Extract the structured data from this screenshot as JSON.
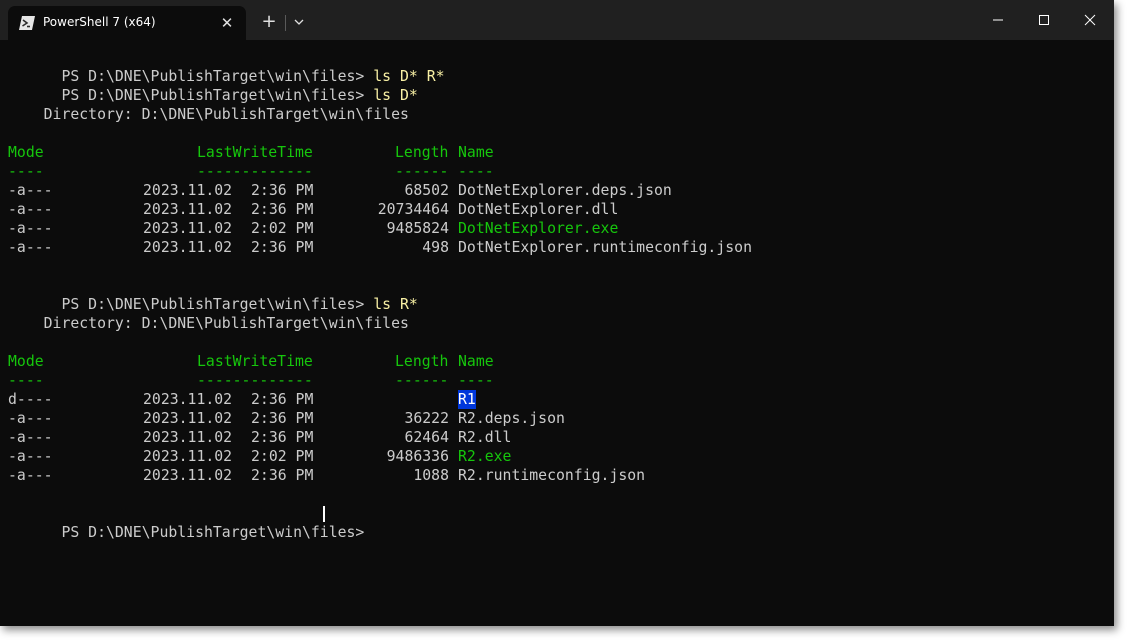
{
  "window": {
    "tab_title": "PowerShell 7 (x64)",
    "icon": "powershell-icon",
    "new_tab_icon": "plus-icon",
    "dropdown_icon": "chevron-down-icon",
    "close_tab_icon": "close-icon",
    "controls": [
      "minimize-icon",
      "maximize-icon",
      "close-icon"
    ]
  },
  "colors": {
    "background": "#0c0c0c",
    "titlebar": "#202020",
    "text": "#cccccc",
    "command": "#f9f1a5",
    "header": "#16c60c",
    "executable": "#16c60c",
    "directory_highlight": "#0037da"
  },
  "terminal": {
    "prompt": "PS D:\\DNE\\PublishTarget\\win\\files> ",
    "commands": [
      "ls D* R*",
      "ls D*",
      "ls R*"
    ],
    "directory_label": "    Directory: D:\\DNE\\PublishTarget\\win\\files",
    "headers": {
      "mode": "Mode",
      "lastwritetime": "LastWriteTime",
      "length": "Length",
      "name": "Name",
      "mode_ul": "----",
      "lastwritetime_ul": "-------------",
      "length_ul": "------",
      "name_ul": "----"
    },
    "listing_d": [
      {
        "mode": "-a---",
        "date": "2023.11.02",
        "time": "2:36 PM",
        "length": "68502",
        "name": "DotNetExplorer.deps.json"
      },
      {
        "mode": "-a---",
        "date": "2023.11.02",
        "time": "2:36 PM",
        "length": "20734464",
        "name": "DotNetExplorer.dll"
      },
      {
        "mode": "-a---",
        "date": "2023.11.02",
        "time": "2:02 PM",
        "length": "9485824",
        "name": "DotNetExplorer.exe"
      },
      {
        "mode": "-a---",
        "date": "2023.11.02",
        "time": "2:36 PM",
        "length": "498",
        "name": "DotNetExplorer.runtimeconfig.json"
      }
    ],
    "listing_r": [
      {
        "mode": "d----",
        "date": "2023.11.02",
        "time": "2:36 PM",
        "length": "",
        "name": "R1"
      },
      {
        "mode": "-a---",
        "date": "2023.11.02",
        "time": "2:36 PM",
        "length": "36222",
        "name": "R2.deps.json"
      },
      {
        "mode": "-a---",
        "date": "2023.11.02",
        "time": "2:36 PM",
        "length": "62464",
        "name": "R2.dll"
      },
      {
        "mode": "-a---",
        "date": "2023.11.02",
        "time": "2:02 PM",
        "length": "9486336",
        "name": "R2.exe"
      },
      {
        "mode": "-a---",
        "date": "2023.11.02",
        "time": "2:36 PM",
        "length": "1088",
        "name": "R2.runtimeconfig.json"
      }
    ]
  }
}
